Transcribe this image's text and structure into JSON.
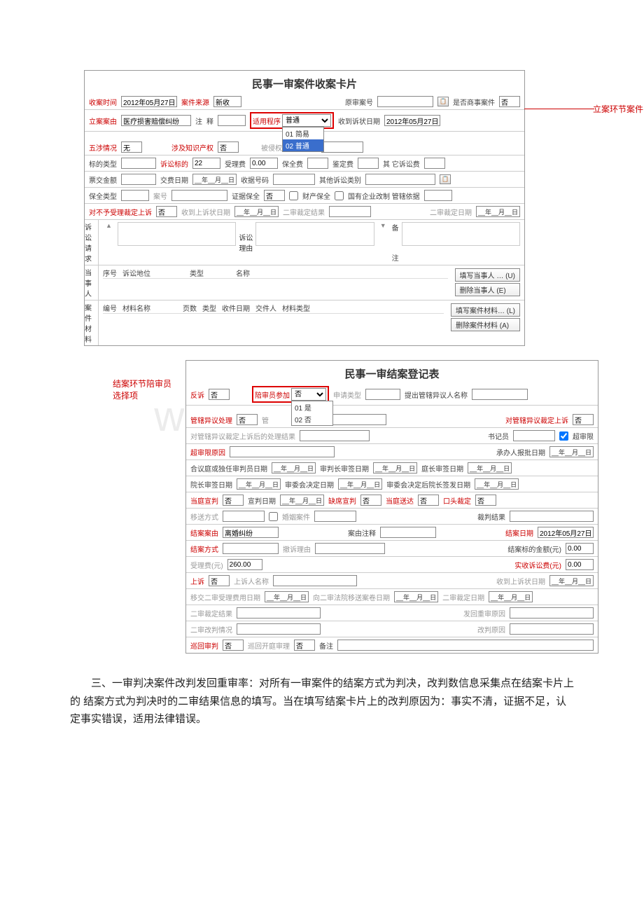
{
  "card1": {
    "title": "民事一审案件收案卡片",
    "annot_right": "立案环节案件",
    "r1": {
      "l1": "收案时间",
      "v1": "2012年05月27日",
      "l2": "案件来源",
      "v2": "新收",
      "l3": "原审案号",
      "l4": "是否商事案件",
      "v4": "否"
    },
    "r2": {
      "l1": "立案案由",
      "v1": "医疗损害赔偿纠纷",
      "l2": "注",
      "l3": "释",
      "boxl": "适用程序",
      "boxv": "普通",
      "dd1": "01  简易",
      "dd2": "02  普通",
      "l4": "收到诉状日期",
      "v4": "2012年05月27日"
    },
    "r3": {
      "l1": "五涉情况",
      "v1": "无",
      "l2": "涉及知识产权",
      "v2": "否",
      "l3": "被侵权方涉及国别"
    },
    "r4": {
      "l1": "标的类型",
      "l2": "诉讼标的",
      "v2": "22",
      "l3": "受理费",
      "v3": "0.00",
      "l4": "保全费",
      "l5": "鉴定费",
      "l6": "其  它诉讼费"
    },
    "r5": {
      "l1": "票交金额",
      "l2": "交费日期",
      "l3": "收据号码",
      "l4": "其他诉讼类别"
    },
    "r6": {
      "l1": "保全类型",
      "l2": "案号",
      "l3": "证据保全",
      "v3": "否",
      "cb1": "财产保全",
      "cb2": "国有企业改制 管辖依据"
    },
    "r7": {
      "l1": "对不予受理裁定上诉",
      "v1": "否",
      "l2": "收到上诉状日期",
      "l3": "二审裁定结果",
      "l4": "二审裁定日期"
    },
    "r8": {
      "tab1": "诉讼请求",
      "mid": "诉讼理由",
      "tab2": "备",
      "tab2b": "注"
    },
    "r9": {
      "tab": "当事人",
      "h1": "序号",
      "h2": "诉讼地位",
      "h3": "类型",
      "h4": "名称",
      "btn1": "填写当事人 … (U)",
      "btn2": "删除当事人    (E)"
    },
    "r10": {
      "tab": "案件材料",
      "h1": "编号",
      "h2": "材料名称",
      "h3": "页数",
      "h4": "类型",
      "h5": "收件日期",
      "h6": "交件人",
      "h7": "材料类型",
      "btn1": "填写案件材料… (L)",
      "btn2": "删除案件材料  (A)"
    },
    "date_placeholder": "__年__月__日"
  },
  "card2": {
    "title": "民事一审结案登记表",
    "annot_left": "结案环节陪审员选择项",
    "r1": {
      "l1": "反诉",
      "v1": "否",
      "boxl": "陪审员参加",
      "boxv": "否",
      "dd1": "01  是",
      "dd2": "02  否",
      "l3": "申请类型",
      "l4": "提出管辖异议人名称"
    },
    "r2": {
      "l1": "管辖异议处理",
      "v1": "否",
      "l2": "管",
      "l3": "结果",
      "l4": "对管辖异议裁定上诉",
      "v4": "否"
    },
    "r3": {
      "l1": "对管辖异议裁定上诉后的处理结果",
      "l2": "书记员",
      "cb": "超审限"
    },
    "r4": {
      "l1": "超审限原因",
      "l2": "承办人报批日期"
    },
    "r5": {
      "l1": "合议庭或独任审判员日期",
      "l2": "审判长审签日期",
      "l3": "庭长审签日期"
    },
    "r6": {
      "l1": "院长审签日期",
      "l2": "审委会决定日期",
      "l3": "审委会决定后院长签发日期"
    },
    "r7": {
      "l1": "当庭宣判",
      "v1": "否",
      "l2": "宣判日期",
      "l3": "缺席宣判",
      "v3": "否",
      "l4": "当庭送达",
      "v4": "否",
      "l5": "口头裁定",
      "v5": "否"
    },
    "r8": {
      "l1": "移送方式",
      "cb": "婚姻案件",
      "l2": "裁判结果"
    },
    "r9": {
      "l1": "结案案由",
      "v1": "离婚纠纷",
      "l2": "案由注释",
      "l3": "结案日期",
      "v3": "2012年05月27日"
    },
    "r10": {
      "l1": "结案方式",
      "l2": "撤诉理由",
      "l3": "结案标的金额(元)",
      "v3": "0.00"
    },
    "r11": {
      "l1": "受理费(元)",
      "v1": "260.00",
      "l2": "实收诉讼费(元)",
      "v2": "0.00"
    },
    "r12": {
      "l1": "上诉",
      "v1": "否",
      "l2": "上诉人名称",
      "l3": "收到上诉状日期"
    },
    "r13": {
      "l1": "移交二审受理费用日期",
      "l2": "向二审法院移送案卷日期",
      "l3": "二审裁定日期"
    },
    "r14": {
      "l1": "二审裁定结果",
      "l2": "发回重审原因"
    },
    "r15": {
      "l1": "二审改判情况",
      "l2": "改判原因"
    },
    "r16": {
      "l1": "巡回审判",
      "v1": "否",
      "l2": "巡回开庭审理",
      "v2": "否",
      "l3": "备注"
    },
    "date_placeholder": "__年__月__日"
  },
  "bodytext": "三、一审判决案件改判发回重审率：对所有一审案件的结案方式为判决，改判数信息采集点在结案卡片上的 结案方式为判决时的二审结果信息的填写。当在填写结案卡片上的改判原因为：事实不清，证据不足，认定事实错误，适用法律错误。"
}
